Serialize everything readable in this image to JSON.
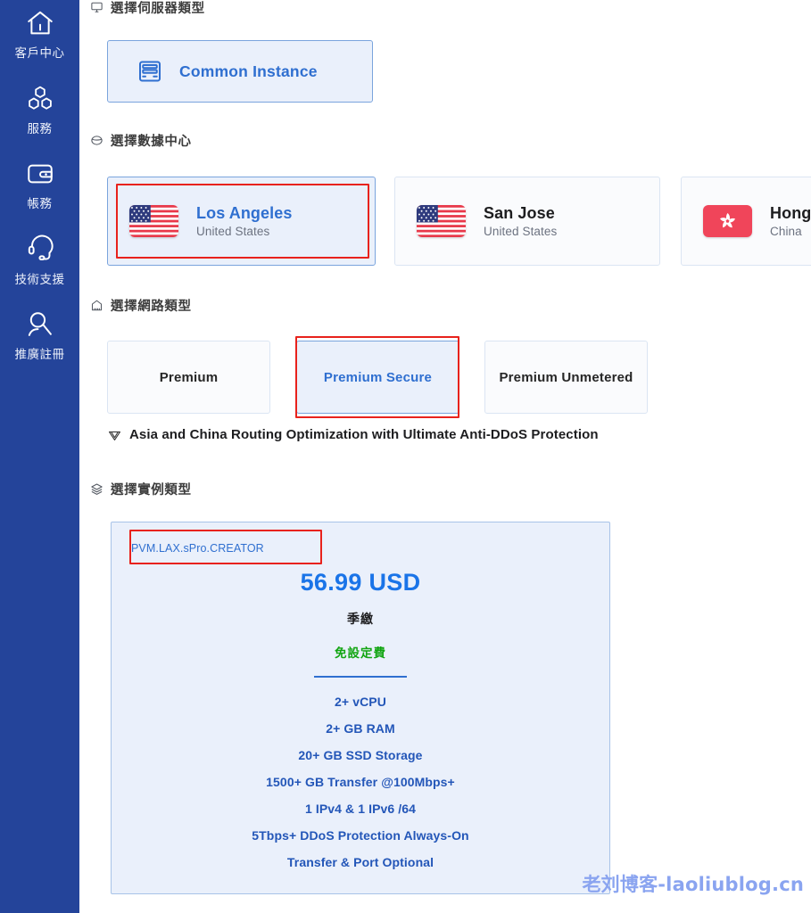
{
  "theme": {
    "sidebar_bg": "#24449a",
    "accent_blue": "#2f6fd0",
    "price_blue": "#1a74e8",
    "spec_blue": "#2356b8",
    "selected_card_bg": "#eaf0fb",
    "selected_card_border": "#7aa4dd",
    "annotation_red": "#e8221c",
    "free_setup_green": "#12a512",
    "watermark_color": "#8aa4f0"
  },
  "sidebar": {
    "items": [
      {
        "label": "客戶中心",
        "icon": "home-icon"
      },
      {
        "label": "服務",
        "icon": "cubes-icon"
      },
      {
        "label": "帳務",
        "icon": "wallet-icon"
      },
      {
        "label": "技術支援",
        "icon": "headset-icon"
      },
      {
        "label": "推廣註冊",
        "icon": "affiliate-user-icon"
      }
    ]
  },
  "sections": {
    "server_type": {
      "heading": "選擇伺服器類型",
      "icon": "server-monitor-icon",
      "options": [
        {
          "label": "Common Instance",
          "icon": "server-rack-icon",
          "selected": true
        }
      ]
    },
    "datacenter": {
      "heading": "選擇數據中心",
      "icon": "globe-icon",
      "options": [
        {
          "city": "Los Angeles",
          "country": "United States",
          "flag": "us-flag-icon",
          "selected": true,
          "annotated": true
        },
        {
          "city": "San Jose",
          "country": "United States",
          "flag": "us-flag-icon",
          "selected": false,
          "annotated": false
        },
        {
          "city": "Hong Kong",
          "country": "China",
          "flag": "hk-flag-icon",
          "selected": false,
          "annotated": false
        }
      ]
    },
    "network_type": {
      "heading": "選擇網路類型",
      "icon": "ethernet-port-icon",
      "options": [
        {
          "label": "Premium",
          "selected": false,
          "annotated": false
        },
        {
          "label": "Premium Secure",
          "selected": true,
          "annotated": true
        },
        {
          "label": "Premium Unmetered",
          "selected": false,
          "annotated": false
        }
      ],
      "note": "Asia and China Routing Optimization with Ultimate Anti-DDoS Protection",
      "note_icon": "shield-icon"
    },
    "instance_type": {
      "heading": "選擇實例類型",
      "icon": "layers-icon",
      "plan": {
        "sku": "PVM.LAX.sPro.CREATOR",
        "sku_annotated": true,
        "price": "56.99 USD",
        "billing_cycle": "季繳",
        "setup_fee": "免設定費",
        "specs": [
          "2+ vCPU",
          "2+ GB RAM",
          "20+ GB SSD Storage",
          "1500+ GB Transfer @100Mbps+",
          "1 IPv4 & 1 IPv6 /64",
          "5Tbps+ DDoS Protection Always-On",
          "Transfer & Port Optional"
        ]
      }
    }
  },
  "watermark": {
    "text": "老刘博客-laoliublog.cn"
  }
}
